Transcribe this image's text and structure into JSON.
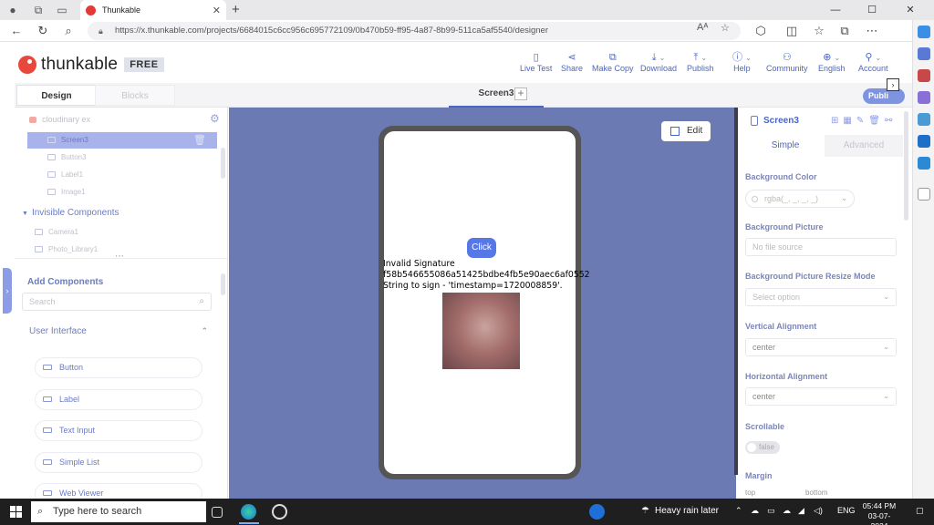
{
  "browser": {
    "tab_title": "Thunkable",
    "url": "https://x.thunkable.com/projects/6684015c6cc956c695772109/0b470b59-ff95-4a87-8b99-511ca5af5540/designer",
    "reader_label": "Aᴬ"
  },
  "app_header": {
    "brand": "thunkable",
    "plan_badge": "FREE",
    "actions": [
      "Live Test",
      "Share",
      "Make Copy",
      "Download",
      "Publish",
      "Help",
      "Community",
      "English",
      "Account"
    ]
  },
  "modebar": {
    "design_label": "Design",
    "blocks_label": "Blocks",
    "screen_tab": "Screen3",
    "publish_label": "Publi"
  },
  "left_panel": {
    "project_name": "cloudinary ex",
    "tree": [
      "Screen3",
      "Button3",
      "Label1",
      "Image1"
    ],
    "invisible_title": "Invisible Components",
    "invisible_items": [
      "Camera1",
      "Photo_Library1"
    ],
    "add_title": "Add Components",
    "search_placeholder": "Search",
    "category": "User Interface",
    "components": [
      "Button",
      "Label",
      "Text Input",
      "Simple List",
      "Web Viewer"
    ]
  },
  "canvas": {
    "edit_label": "Edit",
    "button_text": "Click",
    "label_text": "Invalid Signature\nf58b546655086a51425bdbe4fb5e90aec6af0552\nString to sign - 'timestamp=1720008859'."
  },
  "right_panel": {
    "title": "Screen3",
    "tab_simple": "Simple",
    "tab_advanced": "Advanced",
    "props": {
      "bg_color_label": "Background Color",
      "bg_color_value": "rgba(_, _, _, _)",
      "bg_picture_label": "Background Picture",
      "bg_picture_value": "No file source",
      "resize_label": "Background Picture Resize Mode",
      "resize_value": "Select option",
      "valign_label": "Vertical Alignment",
      "valign_value": "center",
      "halign_label": "Horizontal Alignment",
      "halign_value": "center",
      "scrollable_label": "Scrollable",
      "scrollable_value": "false",
      "margin_label": "Margin",
      "margin_top": "top",
      "margin_bottom": "bottom"
    }
  },
  "taskbar": {
    "search_placeholder": "Type here to search",
    "weather": "Heavy rain later",
    "lang": "ENG",
    "time": "05:44 PM",
    "date": "03-07-2024"
  }
}
